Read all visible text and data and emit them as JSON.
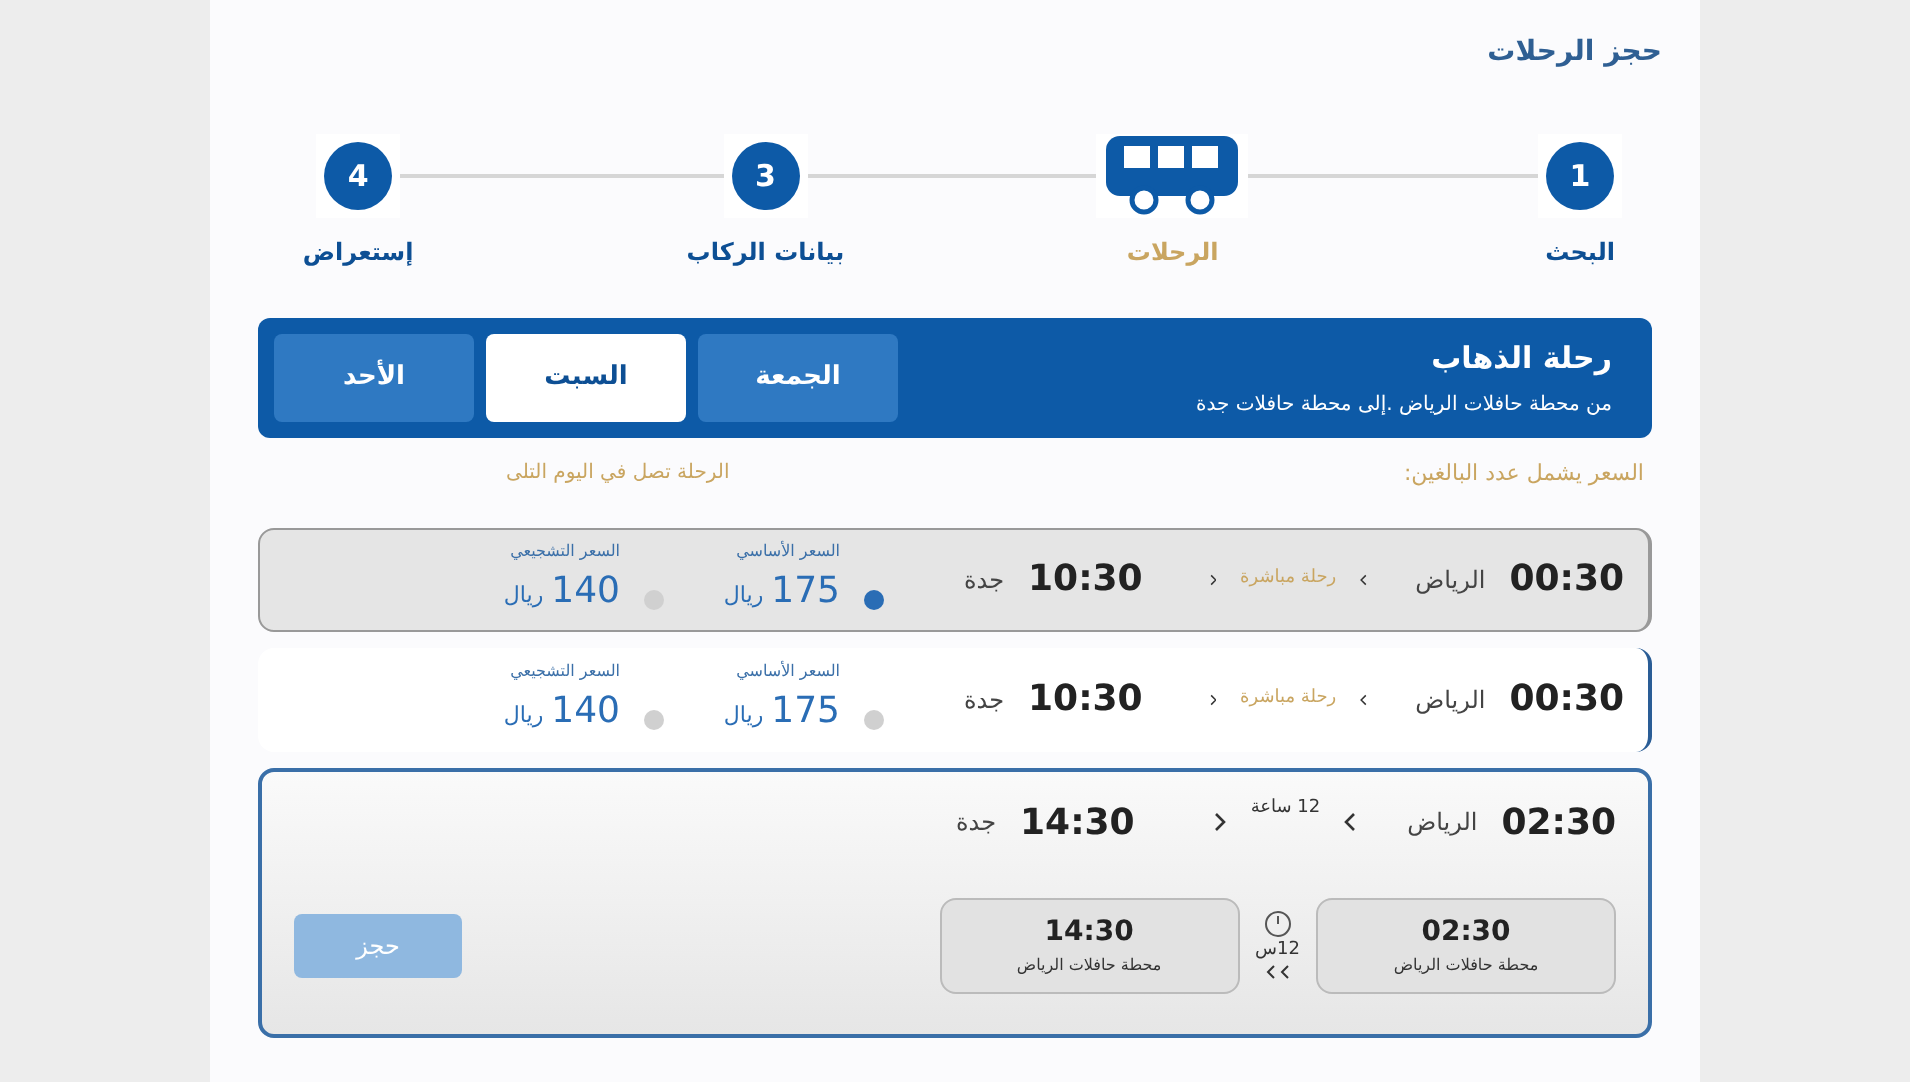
{
  "page_title": "حجز الرحلات",
  "steps": [
    {
      "number": "1",
      "label": "البحث",
      "current": false
    },
    {
      "label": "الرحلات",
      "current": true
    },
    {
      "number": "3",
      "label": "بيانات الركاب",
      "current": false
    },
    {
      "number": "4",
      "label": "إستعراض",
      "current": false
    }
  ],
  "trip_header": {
    "title": "رحلة الذهاب",
    "route": "من محطة حافلات الرياض .إلى محطة حافلات جدة"
  },
  "day_tabs": [
    {
      "label": "الجمعة",
      "selected": false
    },
    {
      "label": "السبت",
      "selected": true
    },
    {
      "label": "الأحد",
      "selected": false
    }
  ],
  "notes": {
    "price_note": "السعر يشمل عدد البالغين:",
    "arrival_note": "الرحلة تصل في اليوم التلى"
  },
  "trips": [
    {
      "selected": true,
      "expanded": false,
      "depart_time": "00:30",
      "depart_city": "الرياض",
      "trip_type": "رحلة مباشرة",
      "arrive_time": "10:30",
      "arrive_city": "جدة",
      "prices": [
        {
          "label": "السعر الأساسي",
          "amount": "175",
          "currency": "ريال",
          "selected": true
        },
        {
          "label": "السعر التشجيعي",
          "amount": "140",
          "currency": "ريال",
          "selected": false
        }
      ]
    },
    {
      "selected": false,
      "expanded": false,
      "depart_time": "00:30",
      "depart_city": "الرياض",
      "trip_type": "رحلة مباشرة",
      "arrive_time": "10:30",
      "arrive_city": "جدة",
      "prices": [
        {
          "label": "السعر الأساسي",
          "amount": "175",
          "currency": "ريال",
          "selected": false
        },
        {
          "label": "السعر التشجيعي",
          "amount": "140",
          "currency": "ريال",
          "selected": false
        }
      ]
    },
    {
      "selected": false,
      "expanded": true,
      "depart_time": "02:30",
      "depart_city": "الرياض",
      "trip_type": "12 ساعة",
      "arrive_time": "14:30",
      "arrive_city": "جدة",
      "details": {
        "depart_time": "02:30",
        "depart_station": "محطة حافلات الرياض",
        "duration": "12س",
        "arrive_time": "14:30",
        "arrive_station": "محطة حافلات الرياض"
      },
      "book_button": {
        "label": "حجز",
        "disabled": true
      }
    }
  ]
}
